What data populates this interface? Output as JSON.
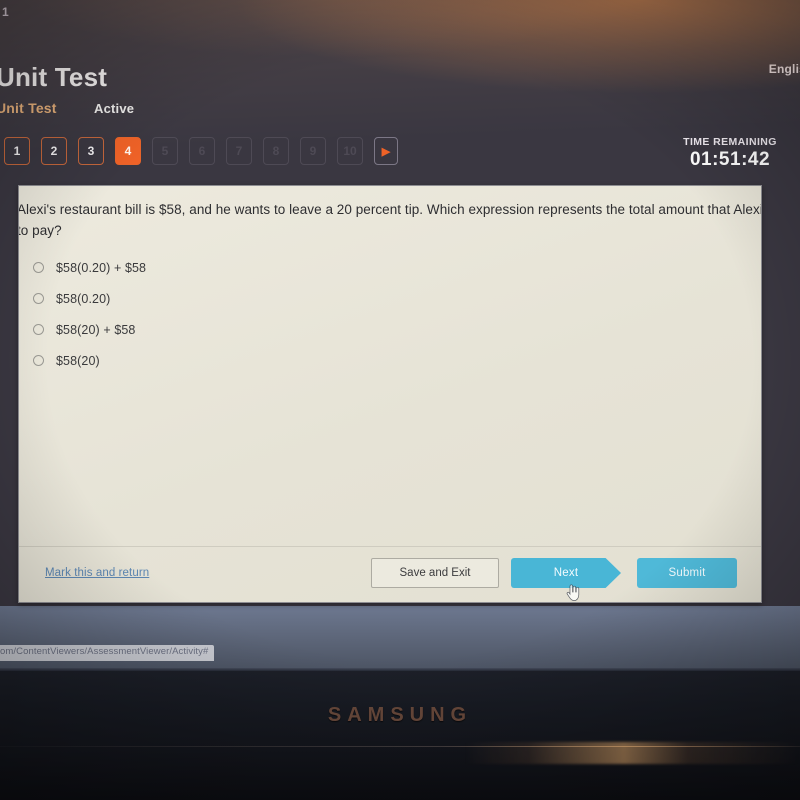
{
  "browser": {
    "tab_number": "1",
    "status_url": "om/ContentViewers/AssessmentViewer/Activity#"
  },
  "header": {
    "language": "Englis",
    "title": "Unit Test",
    "subtitle": "Unit Test",
    "status": "Active"
  },
  "pager": {
    "questions": [
      {
        "label": "1",
        "state": "done"
      },
      {
        "label": "2",
        "state": "done"
      },
      {
        "label": "3",
        "state": "done"
      },
      {
        "label": "4",
        "state": "current"
      },
      {
        "label": "5",
        "state": "locked"
      },
      {
        "label": "6",
        "state": "locked"
      },
      {
        "label": "7",
        "state": "locked"
      },
      {
        "label": "8",
        "state": "locked"
      },
      {
        "label": "9",
        "state": "locked"
      },
      {
        "label": "10",
        "state": "locked"
      }
    ],
    "next_arrow": "▶"
  },
  "timer": {
    "label": "TIME REMAINING",
    "value": "01:51:42"
  },
  "question": {
    "text": "Alexi's restaurant bill is $58, and he wants to leave a 20 percent tip. Which expression represents the total amount that Alexi needs to pay?",
    "options": [
      {
        "label": "$58(0.20) + $58",
        "selected": false
      },
      {
        "label": "$58(0.20)",
        "selected": false
      },
      {
        "label": "$58(20) + $58",
        "selected": false
      },
      {
        "label": "$58(20)",
        "selected": false
      }
    ]
  },
  "footer": {
    "mark_link": "Mark this and return",
    "save_label": "Save and Exit",
    "next_label": "Next",
    "submit_label": "Submit"
  },
  "device": {
    "brand": "SAMSUNG"
  },
  "colors": {
    "accent_orange": "#ef6227",
    "accent_blue": "#4fb9d8",
    "header_bg": "#3a3741",
    "card_bg": "#e9e6da",
    "link_blue": "#5d87b3"
  }
}
